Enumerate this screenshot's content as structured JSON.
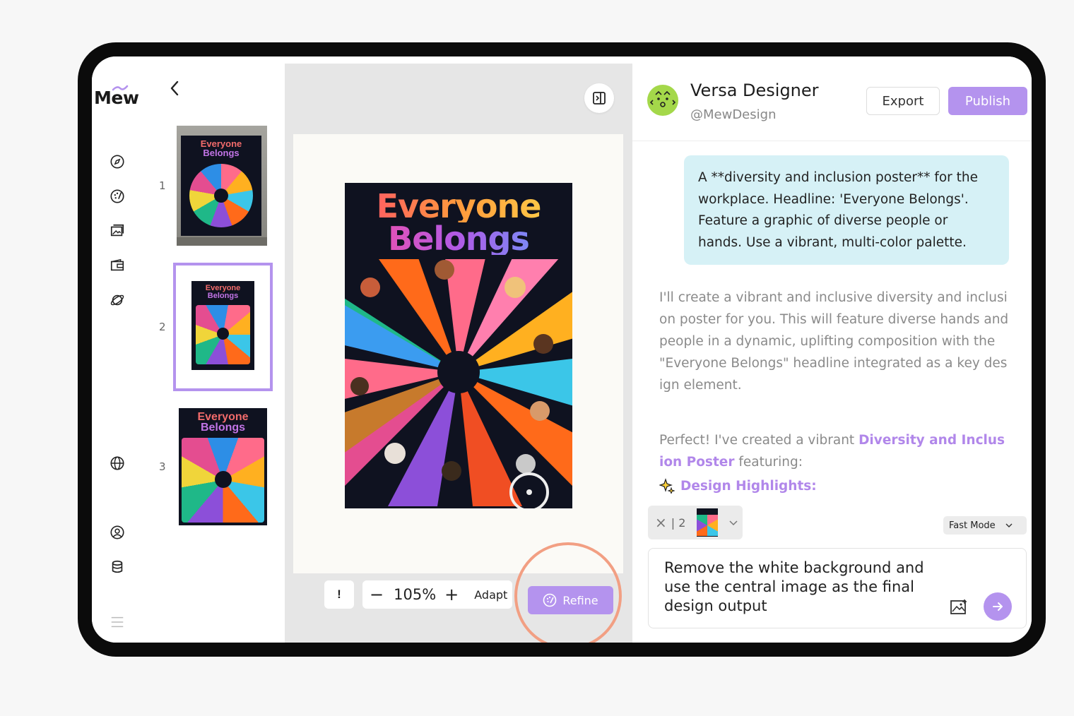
{
  "app": {
    "logo": "Mew"
  },
  "pages": {
    "items": [
      {
        "number": "1",
        "poster_title_line1": "Everyone",
        "poster_title_line2": "Belongs"
      },
      {
        "number": "2",
        "poster_title_line1": "Everyone",
        "poster_title_line2": "Belongs"
      },
      {
        "number": "3",
        "poster_title_line1": "Everyone",
        "poster_title_line2": "Belongs"
      }
    ],
    "selected": "2"
  },
  "canvas": {
    "poster_title_line1": "Everyone",
    "poster_title_line2": "Belongs",
    "bang_label": "!",
    "zoom": "105%",
    "zoom_out": "−",
    "zoom_in": "+",
    "adapt_label": "Adapt",
    "refine_label": "Refine"
  },
  "chat": {
    "agent_name": "Versa Designer",
    "agent_handle": "@MewDesign",
    "export_label": "Export",
    "publish_label": "Publish",
    "user_message": "A **diversity and inclusion poster** for the workplace. Headline: 'Everyone Belongs'. Feature a graphic of diverse people or hands. Use a vibrant, multi-color palette.",
    "bot_message_1": "I'll create a vibrant and inclusive diversity and inclusion poster for you. This will feature diverse hands and people in a dynamic, uplifting composition with the \"Everyone Belongs\" headline integrated as a key design element.",
    "bot_message_2_prefix": "Perfect! I've created a vibrant ",
    "bot_message_2_accent": "Diversity and Inclusion Poster",
    "bot_message_2_suffix": " featuring:",
    "highlights_label": "Design Highlights:",
    "attachment_close": "×",
    "attachment_count": "| 2",
    "mode": "Fast Mode",
    "input_value": "Remove the white background and use the central image as the final design output"
  },
  "colors": {
    "accent": "#b493ee",
    "user_bubble": "#d6f1f6",
    "highlight_ring": "#f29f83"
  }
}
